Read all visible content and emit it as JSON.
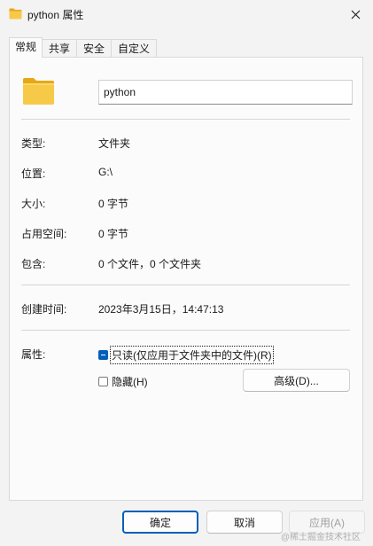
{
  "window": {
    "title": "python 属性",
    "close_glyph": "✕"
  },
  "tabs": [
    {
      "label": "常规",
      "active": true
    },
    {
      "label": "共享",
      "active": false
    },
    {
      "label": "安全",
      "active": false
    },
    {
      "label": "自定义",
      "active": false
    }
  ],
  "general": {
    "name_value": "python",
    "fields": {
      "type": {
        "label": "类型:",
        "value": "文件夹"
      },
      "location": {
        "label": "位置:",
        "value": "G:\\"
      },
      "size": {
        "label": "大小:",
        "value": "0 字节"
      },
      "size_on_disk": {
        "label": "占用空间:",
        "value": "0 字节"
      },
      "contains": {
        "label": "包含:",
        "value": "0 个文件，0 个文件夹"
      },
      "created": {
        "label": "创建时间:",
        "value": "2023年3月15日，14:47:13"
      }
    },
    "attributes": {
      "label": "属性:",
      "readonly": {
        "label": "只读(仅应用于文件夹中的文件)(R)",
        "state": "indeterminate"
      },
      "hidden": {
        "label": "隐藏(H)",
        "state": "unchecked"
      },
      "advanced_button": "高级(D)..."
    }
  },
  "footer": {
    "ok": "确定",
    "cancel": "取消",
    "apply": "应用(A)"
  },
  "watermark": "@稀土掘金技术社区",
  "colors": {
    "accent": "#005fb8",
    "folder_yellow": "#f7c948",
    "folder_dark": "#e6a817"
  },
  "icons": {
    "title": "folder-icon",
    "close": "close-icon",
    "folder_large": "folder-icon"
  }
}
